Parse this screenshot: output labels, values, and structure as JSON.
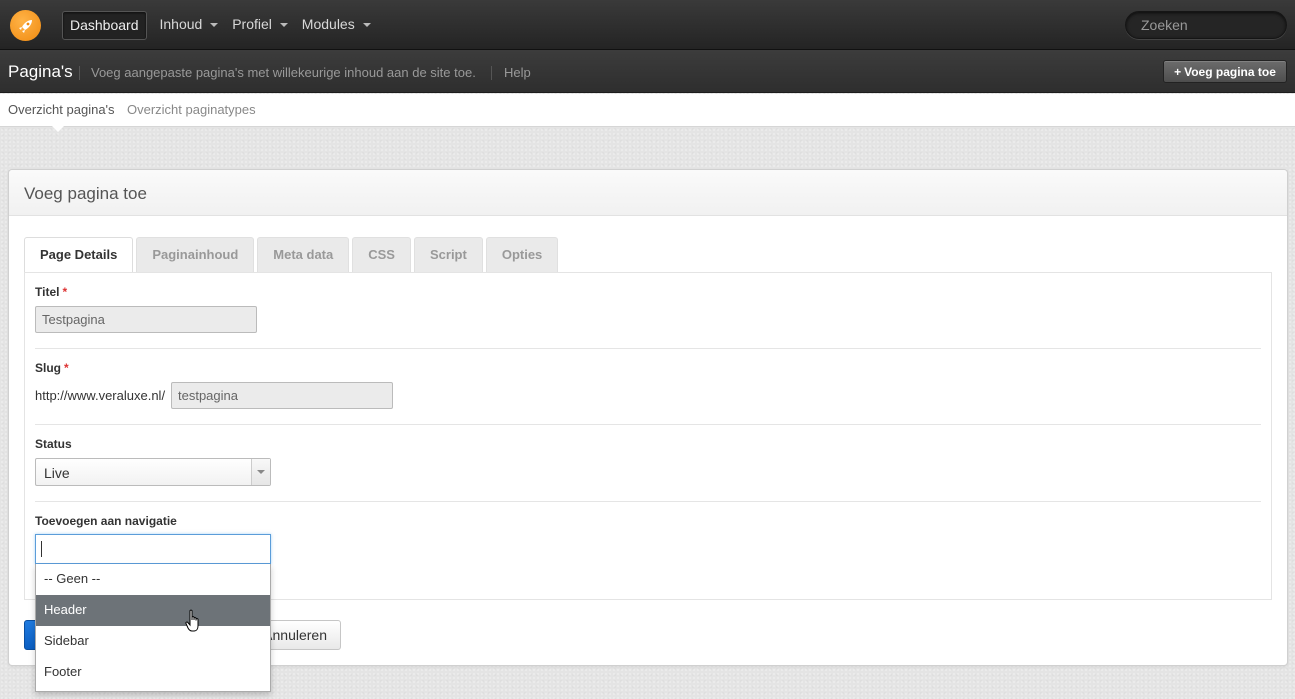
{
  "topbar": {
    "nav": [
      {
        "label": "Dashboard",
        "active": true,
        "has_caret": false
      },
      {
        "label": "Inhoud",
        "active": false,
        "has_caret": true
      },
      {
        "label": "Profiel",
        "active": false,
        "has_caret": true
      },
      {
        "label": "Modules",
        "active": false,
        "has_caret": true
      }
    ],
    "search_placeholder": "Zoeken",
    "logo_icon": "rocket-icon"
  },
  "subheader": {
    "title": "Pagina's",
    "description": "Voeg aangepaste pagina's met willekeurige inhoud aan de site toe.",
    "help": "Help",
    "add_button": "Voeg pagina toe"
  },
  "subnav": {
    "items": [
      "Overzicht pagina's",
      "Overzicht paginatypes"
    ],
    "active_index": 0
  },
  "panel": {
    "title": "Voeg pagina toe"
  },
  "tabs": [
    {
      "label": "Page Details",
      "active": true
    },
    {
      "label": "Paginainhoud",
      "active": false
    },
    {
      "label": "Meta data",
      "active": false
    },
    {
      "label": "CSS",
      "active": false
    },
    {
      "label": "Script",
      "active": false
    },
    {
      "label": "Opties",
      "active": false
    }
  ],
  "form": {
    "title_label": "Titel",
    "title_value": "Testpagina",
    "slug_label": "Slug",
    "slug_prefix": "http://www.veraluxe.nl/",
    "slug_value": "testpagina",
    "status_label": "Status",
    "status_value": "Live",
    "nav_label": "Toevoegen aan navigatie",
    "nav_search_value": "",
    "nav_options": [
      "-- Geen --",
      "Header",
      "Sidebar",
      "Footer"
    ],
    "nav_hover_index": 1,
    "required_mark": "*"
  },
  "buttons": {
    "cancel": "Annuleren"
  },
  "colors": {
    "primary": "#0b5fc2",
    "accent_orange": "#f08a10",
    "hover_option": "#6d7378"
  }
}
